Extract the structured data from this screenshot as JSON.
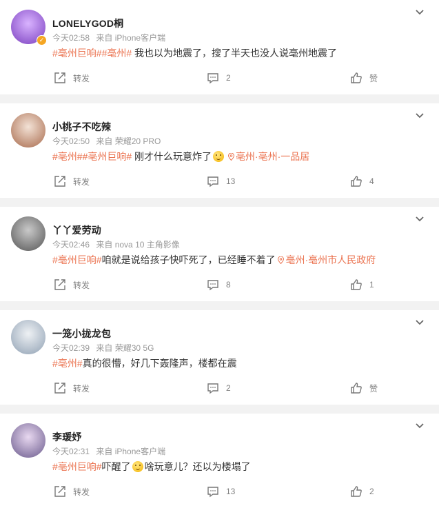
{
  "labels": {
    "repost": "转发"
  },
  "comments": [
    {
      "user": "LONELYGOD桐",
      "verified": true,
      "time": "今天02:58",
      "source": "来自 iPhone客户端",
      "tags": [
        "#亳州巨响#",
        "#亳州#"
      ],
      "text": " 我也以为地震了，搜了半天也没人说亳州地震了",
      "location": "",
      "comment_count": "2",
      "like_count": "赞",
      "avatar_colors": [
        "#d9b3ff",
        "#7a3fbf"
      ]
    },
    {
      "user": "小桃子不吃辣",
      "verified": false,
      "time": "今天02:50",
      "source": "来自 荣耀20 PRO",
      "tags": [
        "#亳州#",
        "#亳州巨响#"
      ],
      "text": " 刚才什么玩意炸了",
      "emoji": "grin-emoji",
      "location": "亳州·亳州·一品居",
      "comment_count": "13",
      "like_count": "4",
      "avatar_colors": [
        "#f3e2d6",
        "#a86a4c"
      ]
    },
    {
      "user": "丫丫爱劳动",
      "verified": false,
      "time": "今天02:46",
      "source": "来自 nova 10 主角影像",
      "tags": [
        "#亳州巨响#"
      ],
      "text": "咱就是说给孩子快吓死了，已经睡不着了",
      "location": "亳州·亳州市人民政府",
      "comment_count": "8",
      "like_count": "1",
      "avatar_colors": [
        "#c9c9c9",
        "#555555"
      ]
    },
    {
      "user": "一笼小拢龙包",
      "verified": false,
      "time": "今天02:39",
      "source": "来自 荣耀30 5G",
      "tags": [
        "#亳州#"
      ],
      "text": "真的很懵，好几下轰隆声，楼都在震",
      "location": "",
      "comment_count": "2",
      "like_count": "赞",
      "avatar_colors": [
        "#eef1f4",
        "#8fa0b3"
      ]
    },
    {
      "user": "李瑗妤",
      "verified": false,
      "time": "今天02:31",
      "source": "来自 iPhone客户端",
      "tags": [
        "#亳州巨响#"
      ],
      "text": "吓醒了",
      "emoji": "sleepy-emoji",
      "text2": "啥玩意儿？还以为楼塌了",
      "location": "",
      "comment_count": "13",
      "like_count": "2",
      "avatar_colors": [
        "#e8d8f0",
        "#6a5a8c"
      ]
    }
  ]
}
